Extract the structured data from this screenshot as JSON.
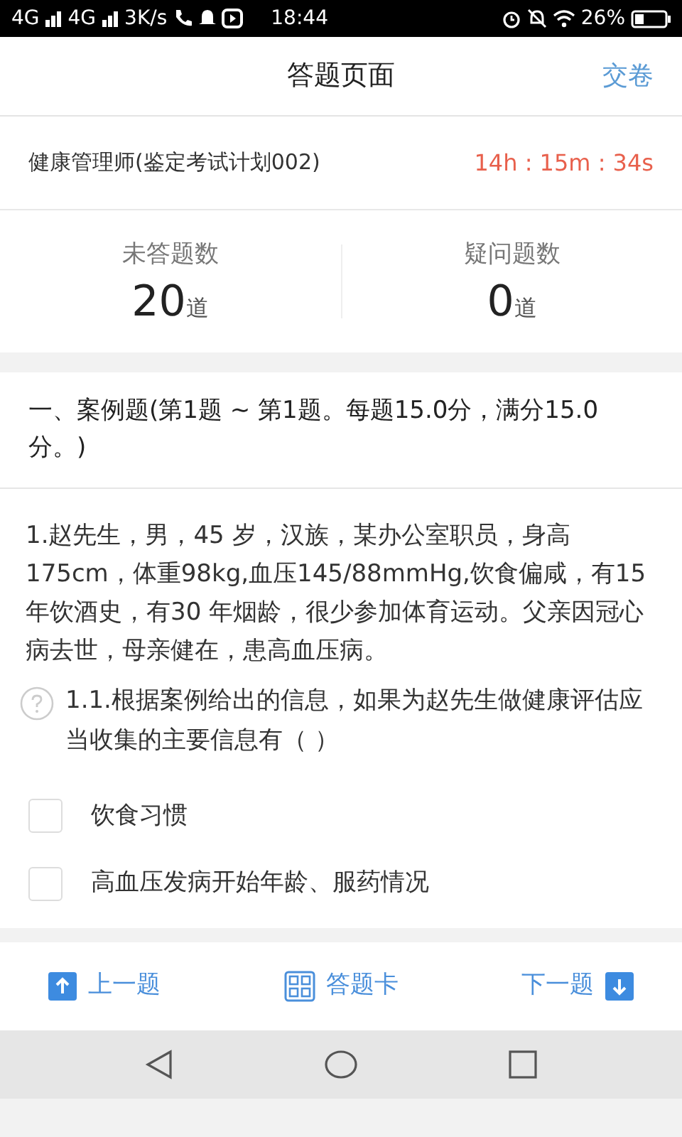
{
  "status_bar": {
    "network_1": "4G",
    "network_2": "4G",
    "speed": "3K/s",
    "time": "18:44",
    "battery": "26%"
  },
  "header": {
    "title": "答题页面",
    "submit": "交卷"
  },
  "exam": {
    "name": "健康管理师(鉴定考试计划002)",
    "timer": "14h : 15m : 34s"
  },
  "stats": [
    {
      "label": "未答题数",
      "count": "20",
      "unit": "道"
    },
    {
      "label": "疑问题数",
      "count": "0",
      "unit": "道"
    }
  ],
  "section": {
    "title": "一、案例题(第1题 ~ 第1题。每题15.0分，满分15.0分。)"
  },
  "case": {
    "text": "1.赵先生，男，45 岁，汉族，某办公室职员，身高175cm，体重98kg,血压145/88mmHg,饮食偏咸，有15 年饮酒史，有30 年烟龄，很少参加体育运动。父亲因冠心病去世，母亲健在，患高血压病。"
  },
  "question": {
    "text": "1.1.根据案例给出的信息，如果为赵先生做健康评估应当收集的主要信息有（ ）",
    "marked": false
  },
  "options": [
    {
      "label": "饮食习惯",
      "checked": false
    },
    {
      "label": "高血压发病开始年龄、服药情况",
      "checked": false
    }
  ],
  "bottom_nav": {
    "prev": "上一题",
    "card": "答题卡",
    "next": "下一题"
  }
}
